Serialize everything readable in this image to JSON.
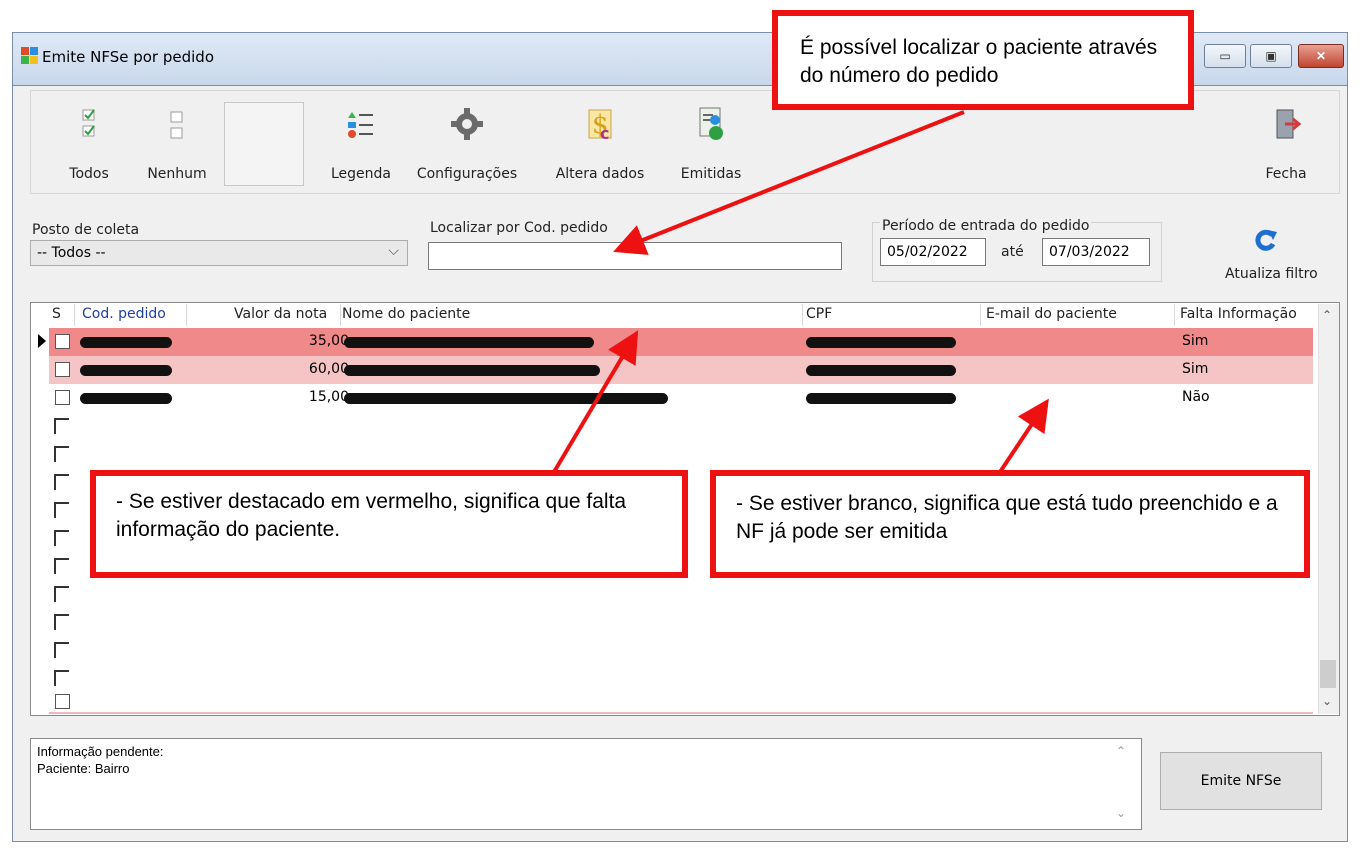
{
  "window": {
    "title": "Emite NFSe por pedido",
    "controls": {
      "minimize": "▭",
      "maximize": "▣",
      "close": "✕"
    }
  },
  "toolbar": {
    "todos": "Todos",
    "nenhum": "Nenhum",
    "legenda": "Legenda",
    "configuracoes": "Configurações",
    "altera_dados": "Altera dados",
    "emitidas": "Emitidas",
    "fecha": "Fecha"
  },
  "filters": {
    "posto_label": "Posto de coleta",
    "posto_value": "-- Todos --",
    "localizar_label": "Localizar por Cod. pedido",
    "localizar_value": "",
    "periodo_label": "Período de entrada do pedido",
    "date_from": "05/02/2022",
    "ate": "até",
    "date_to": "07/03/2022",
    "atualiza": "Atualiza filtro"
  },
  "grid": {
    "headers": {
      "s": "S",
      "cod": "Cod. pedido",
      "valor": "Valor da nota",
      "nome": "Nome do paciente",
      "cpf": "CPF",
      "email": "E-mail do paciente",
      "falta": "Falta Informação"
    },
    "rows": [
      {
        "valor": "35,00",
        "falta": "Sim",
        "status_color": "#f08a8a"
      },
      {
        "valor": "60,00",
        "falta": "Sim",
        "status_color": "#f5c4c4"
      },
      {
        "valor": "15,00",
        "falta": "Não",
        "status_color": "#ffffff"
      }
    ]
  },
  "info": {
    "line1": "Informação pendente:",
    "line2": "Paciente:  Bairro"
  },
  "emite_button": "Emite NFSe",
  "callouts": {
    "top": "É possível localizar o paciente através do número do pedido",
    "left": "- Se estiver destacado em vermelho, significa que falta informação do paciente.",
    "right": "- Se estiver branco, significa que está tudo preenchido e a NF já pode ser emitida"
  },
  "colors": {
    "annotation_red": "#ee1111",
    "row_missing_strong": "#f08a8a",
    "row_missing_light": "#f5c4c4",
    "refresh_blue": "#1f6fd1"
  }
}
